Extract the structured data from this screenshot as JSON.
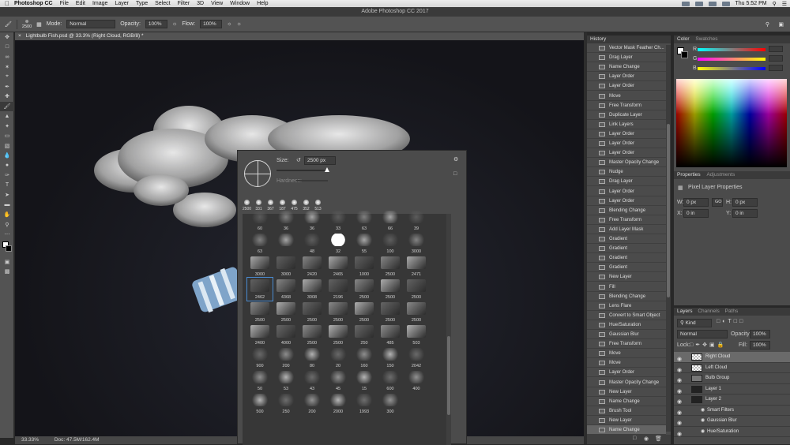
{
  "menubar": {
    "app": "Photoshop CC",
    "items": [
      "File",
      "Edit",
      "Image",
      "Layer",
      "Type",
      "Select",
      "Filter",
      "3D",
      "View",
      "Window",
      "Help"
    ],
    "clock": "Thu 5:52 PM"
  },
  "window": {
    "title": "Adobe Photoshop CC 2017"
  },
  "options": {
    "brush_size": "2500",
    "mode_label": "Mode:",
    "mode_value": "Normal",
    "opacity_label": "Opacity:",
    "opacity_value": "100%",
    "flow_label": "Flow:",
    "flow_value": "100%"
  },
  "document": {
    "tab": "Lightbulb Fish.psd @ 33.3% (Right Cloud, RGB/8) *",
    "zoom": "33.33%",
    "doc_size": "Doc: 47.5M/162.4M"
  },
  "brush_popup": {
    "size_label": "Size:",
    "size_value": "2500 px",
    "hardness_label": "Hardness:",
    "recent": [
      "2500",
      "331",
      "367",
      "187",
      "475",
      "352",
      "513"
    ],
    "grid_numbers": [
      "60",
      "36",
      "36",
      "33",
      "63",
      "66",
      "39",
      "63",
      "",
      "48",
      "32",
      "55",
      "100",
      "3000",
      "3000",
      "3000",
      "2420",
      "2465",
      "1000",
      "2500",
      "2471",
      "2462",
      "4368",
      "3008",
      "2196",
      "2500",
      "2500",
      "2500",
      "2500",
      "2500",
      "2500",
      "2500",
      "2500",
      "2500",
      "2500",
      "2400",
      "4000",
      "2500",
      "2500",
      "250",
      "485",
      "503",
      "900",
      "200",
      "80",
      "20",
      "160",
      "150",
      "2042",
      "50",
      "53",
      "43",
      "45",
      "15",
      "600",
      "400",
      "500",
      "250",
      "200",
      "2000",
      "1993",
      "300"
    ]
  },
  "history": {
    "title": "History",
    "items": [
      "Vector Mask Feather Ch...",
      "Drag Layer",
      "Name Change",
      "Layer Order",
      "Layer Order",
      "Move",
      "Free Transform",
      "Duplicate Layer",
      "Link Layers",
      "Layer Order",
      "Layer Order",
      "Layer Order",
      "Master Opacity Change",
      "Nudge",
      "Drag Layer",
      "Layer Order",
      "Layer Order",
      "Blending Change",
      "Free Transform",
      "Add Layer Mask",
      "Gradient",
      "Gradient",
      "Gradient",
      "Gradient",
      "New Layer",
      "Fill",
      "Blending Change",
      "Lens Flare",
      "Convert to Smart Object",
      "Hue/Saturation",
      "Gaussian Blur",
      "Free Transform",
      "Move",
      "Move",
      "Layer Order",
      "Master Opacity Change",
      "New Layer",
      "Name Change",
      "Brush Tool",
      "New Layer",
      "Name Change"
    ]
  },
  "color": {
    "tabs": [
      "Color",
      "Swatches"
    ],
    "labels": [
      "R",
      "G",
      "B"
    ]
  },
  "properties": {
    "tabs": [
      "Properties",
      "Adjustments"
    ],
    "title": "Pixel Layer Properties",
    "w_label": "W:",
    "w_value": "0 px",
    "go_label": "GO",
    "h_label": "H:",
    "h_value": "0 px",
    "x_label": "X:",
    "x_value": "0 in",
    "y_label": "Y:",
    "y_value": "0 in"
  },
  "layers": {
    "tabs": [
      "Layers",
      "Channels",
      "Paths"
    ],
    "kind": "Kind",
    "blend": "Normal",
    "opacity_label": "Opacity:",
    "opacity_value": "100%",
    "lock_label": "Lock:",
    "fill_label": "Fill:",
    "fill_value": "100%",
    "items": [
      "Right Cloud",
      "Left Cloud",
      "Bulb Group",
      "Layer 1",
      "Layer 2",
      "Smart Filters",
      "Gaussian Blur",
      "Hue/Saturation"
    ]
  },
  "colors": {
    "accent": "#2d7bd1",
    "panel": "#4b4b4b",
    "toolbar": "#535353"
  }
}
